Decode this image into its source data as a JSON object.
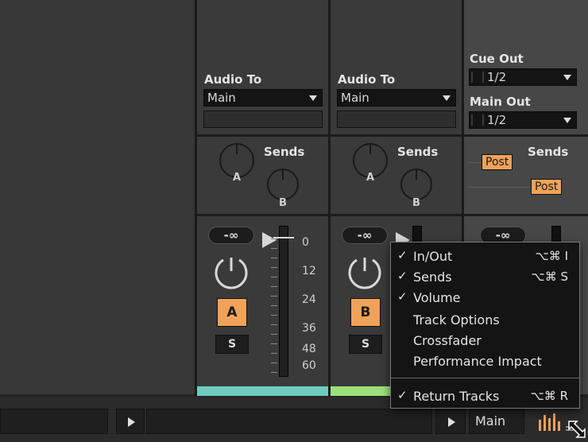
{
  "tracks": [
    {
      "audio_to_label": "Audio To",
      "audio_to_value": "Main",
      "sends_label": "Sends",
      "send_a": "A",
      "send_b": "B",
      "volume": "-∞",
      "activator": "A",
      "solo": "S",
      "color": "#6ecbbd"
    },
    {
      "audio_to_label": "Audio To",
      "audio_to_value": "Main",
      "sends_label": "Sends",
      "send_a": "A",
      "send_b": "B",
      "volume": "-∞",
      "activator": "B",
      "solo": "S",
      "color": "#9be07a"
    }
  ],
  "master": {
    "cue_out_label": "Cue Out",
    "cue_out_value": "1/2",
    "main_out_label": "Main Out",
    "main_out_value": "1/2",
    "sends_label": "Sends",
    "post_1": "Post",
    "post_2": "Post",
    "volume": "-∞"
  },
  "fader_scale": [
    "0",
    "12",
    "24",
    "36",
    "48",
    "60"
  ],
  "context_menu": {
    "items": [
      {
        "checked": true,
        "check": "✓",
        "label": "In/Out",
        "shortcut": "⌥⌘ I"
      },
      {
        "checked": true,
        "check": "✓",
        "label": "Sends",
        "shortcut": "⌥⌘ S"
      },
      {
        "checked": true,
        "check": "✓",
        "label": "Volume",
        "shortcut": ""
      },
      {
        "checked": false,
        "check": "",
        "label": "Track Options",
        "shortcut": ""
      },
      {
        "checked": false,
        "check": "",
        "label": "Crossfader",
        "shortcut": ""
      },
      {
        "checked": false,
        "check": "",
        "label": "Performance Impact",
        "shortcut": ""
      }
    ],
    "footer_item": {
      "checked": true,
      "check": "✓",
      "label": "Return Tracks",
      "shortcut": "⌥⌘ R"
    }
  },
  "bottom_bar": {
    "output_label": "Main"
  },
  "colors": {
    "accent": "#f0a259",
    "menu_bg": "#141414",
    "track1": "#6ecbbd",
    "track2": "#9be07a"
  }
}
